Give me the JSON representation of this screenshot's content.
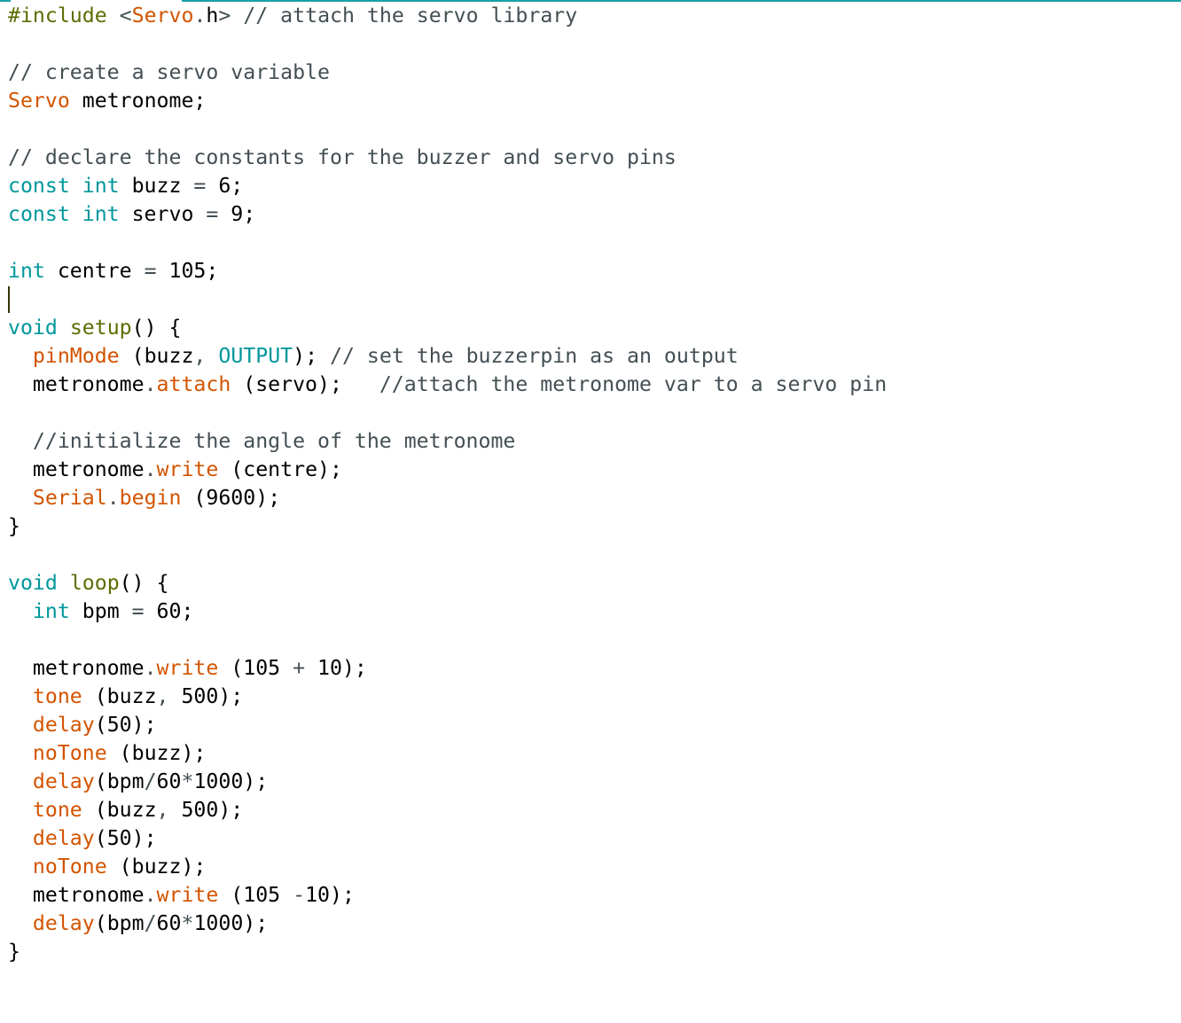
{
  "editor": {
    "cursor_line": 11,
    "colors": {
      "keyword": "#00979c",
      "function": "#d35400",
      "preprocessor": "#5e6d03",
      "comment": "#434f54",
      "accent": "#17a1a5"
    },
    "lines": [
      [
        [
          "#include",
          "p"
        ],
        [
          " ",
          ""
        ],
        [
          "<",
          "o"
        ],
        [
          "Servo",
          "f"
        ],
        [
          ".",
          "o"
        ],
        [
          "h",
          ""
        ],
        [
          ">",
          "o"
        ],
        [
          " // attach the servo library",
          "c"
        ]
      ],
      [],
      [
        [
          "// create a servo variable",
          "c"
        ]
      ],
      [
        [
          "Servo",
          "f"
        ],
        [
          " metronome;",
          ""
        ]
      ],
      [],
      [
        [
          "// declare the constants for the buzzer and servo pins",
          "c"
        ]
      ],
      [
        [
          "const int",
          "k"
        ],
        [
          " buzz ",
          ""
        ],
        [
          "=",
          "o"
        ],
        [
          " 6;",
          ""
        ]
      ],
      [
        [
          "const int",
          "k"
        ],
        [
          " servo ",
          ""
        ],
        [
          "=",
          "o"
        ],
        [
          " 9;",
          ""
        ]
      ],
      [],
      [
        [
          "int",
          "k"
        ],
        [
          " centre ",
          ""
        ],
        [
          "=",
          "o"
        ],
        [
          " 105;",
          ""
        ]
      ],
      [],
      [
        [
          "void",
          "k"
        ],
        [
          " ",
          ""
        ],
        [
          "setup",
          "p"
        ],
        [
          "() {",
          ""
        ]
      ],
      [
        [
          "  ",
          ""
        ],
        [
          "pinMode",
          "f"
        ],
        [
          " (buzz",
          ""
        ],
        [
          ",",
          "o"
        ],
        [
          " ",
          ""
        ],
        [
          "OUTPUT",
          "k"
        ],
        [
          "); ",
          ""
        ],
        [
          "// set the buzzerpin as an output",
          "c"
        ]
      ],
      [
        [
          "  metronome",
          ""
        ],
        [
          ".",
          "o"
        ],
        [
          "attach",
          "f"
        ],
        [
          " (servo);   ",
          ""
        ],
        [
          "//attach the metronome var to a servo pin",
          "c"
        ]
      ],
      [],
      [
        [
          "  ",
          ""
        ],
        [
          "//initialize the angle of the metronome",
          "c"
        ]
      ],
      [
        [
          "  metronome",
          ""
        ],
        [
          ".",
          "o"
        ],
        [
          "write",
          "f"
        ],
        [
          " (centre);",
          ""
        ]
      ],
      [
        [
          "  ",
          ""
        ],
        [
          "Serial",
          "f"
        ],
        [
          ".",
          "o"
        ],
        [
          "begin",
          "f"
        ],
        [
          " (9600);",
          ""
        ]
      ],
      [
        [
          "}",
          ""
        ]
      ],
      [],
      [
        [
          "void",
          "k"
        ],
        [
          " ",
          ""
        ],
        [
          "loop",
          "p"
        ],
        [
          "() {",
          ""
        ]
      ],
      [
        [
          "  ",
          ""
        ],
        [
          "int",
          "k"
        ],
        [
          " bpm ",
          ""
        ],
        [
          "=",
          "o"
        ],
        [
          " 60;",
          ""
        ]
      ],
      [],
      [
        [
          "  metronome",
          ""
        ],
        [
          ".",
          "o"
        ],
        [
          "write",
          "f"
        ],
        [
          " (105 ",
          ""
        ],
        [
          "+",
          "o"
        ],
        [
          " 10);",
          ""
        ]
      ],
      [
        [
          "  ",
          ""
        ],
        [
          "tone",
          "f"
        ],
        [
          " (buzz",
          ""
        ],
        [
          ",",
          "o"
        ],
        [
          " 500);",
          ""
        ]
      ],
      [
        [
          "  ",
          ""
        ],
        [
          "delay",
          "f"
        ],
        [
          "(50);",
          ""
        ]
      ],
      [
        [
          "  ",
          ""
        ],
        [
          "noTone",
          "f"
        ],
        [
          " (buzz);",
          ""
        ]
      ],
      [
        [
          "  ",
          ""
        ],
        [
          "delay",
          "f"
        ],
        [
          "(bpm",
          ""
        ],
        [
          "/",
          "o"
        ],
        [
          "60",
          ""
        ],
        [
          "*",
          "o"
        ],
        [
          "1000);",
          ""
        ]
      ],
      [
        [
          "  ",
          ""
        ],
        [
          "tone",
          "f"
        ],
        [
          " (buzz",
          ""
        ],
        [
          ",",
          "o"
        ],
        [
          " 500);",
          ""
        ]
      ],
      [
        [
          "  ",
          ""
        ],
        [
          "delay",
          "f"
        ],
        [
          "(50);",
          ""
        ]
      ],
      [
        [
          "  ",
          ""
        ],
        [
          "noTone",
          "f"
        ],
        [
          " (buzz);",
          ""
        ]
      ],
      [
        [
          "  metronome",
          ""
        ],
        [
          ".",
          "o"
        ],
        [
          "write",
          "f"
        ],
        [
          " (105 ",
          ""
        ],
        [
          "-",
          "o"
        ],
        [
          "10);",
          ""
        ]
      ],
      [
        [
          "  ",
          ""
        ],
        [
          "delay",
          "f"
        ],
        [
          "(bpm",
          ""
        ],
        [
          "/",
          "o"
        ],
        [
          "60",
          ""
        ],
        [
          "*",
          "o"
        ],
        [
          "1000);",
          ""
        ]
      ],
      [
        [
          "}",
          ""
        ]
      ]
    ]
  }
}
